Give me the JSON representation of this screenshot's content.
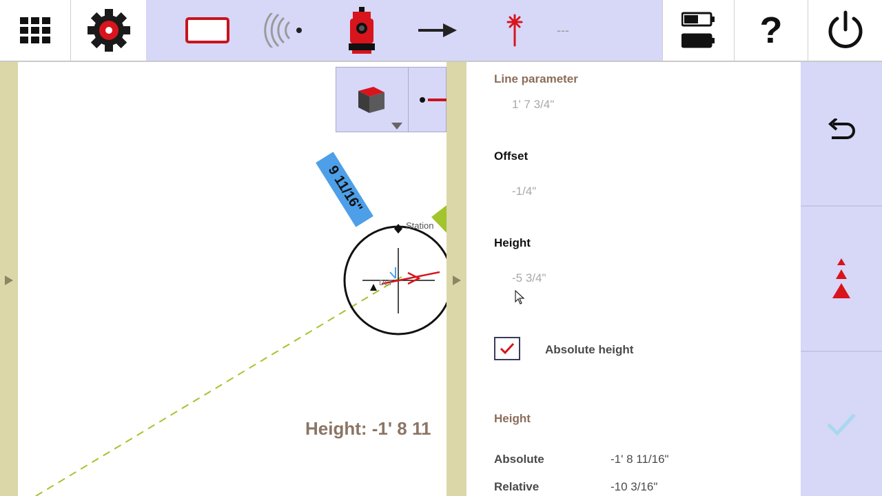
{
  "topbar": {
    "icons": [
      "apps-grid-icon",
      "settings-gear-icon",
      "display-screen-icon",
      "wireless-signal-icon",
      "total-station-icon",
      "arrow-right-icon",
      "laser-target-icon",
      "battery-icon",
      "help-icon",
      "power-icon"
    ],
    "dash_text": "---",
    "help_glyph": "?"
  },
  "map": {
    "dimension_label": "9 11/16\"",
    "station_label": "Station",
    "station_small_label": "DLT",
    "height_label": "Height: -1' 8 11"
  },
  "panel": {
    "line_parameter_label": "Line parameter",
    "line_parameter_value": "1' 7 3/4\"",
    "offset_label": "Offset",
    "offset_value": "-1/4\"",
    "height_input_label": "Height",
    "height_input_value": "-5 3/4\"",
    "absolute_height_label": "Absolute height",
    "absolute_height_checked": true,
    "height_section_label": "Height",
    "rows": [
      {
        "label": "Absolute",
        "value": "-1' 8 11/16\""
      },
      {
        "label": "Relative",
        "value": "-10 3/16\""
      }
    ]
  },
  "right_bar": {
    "icons": [
      "undo-icon",
      "stakeout-triangles-icon",
      "confirm-check-icon"
    ]
  },
  "colors": {
    "toolbar_bg": "#d7d7f8",
    "strip_bg": "#dbd7a8",
    "accent_red": "#d8141c",
    "label_brown": "#8b6d5a",
    "dimension_blue": "#4d9fe8",
    "dashed_line_green": "#a2c42c"
  }
}
